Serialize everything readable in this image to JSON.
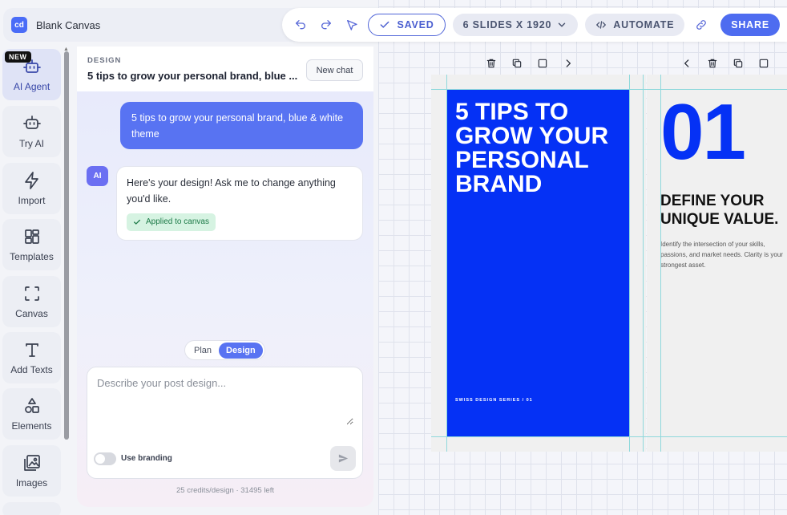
{
  "header": {
    "app_title": "Blank Canvas",
    "logo_text": "cd"
  },
  "toolbar": {
    "saved_label": "SAVED",
    "slides_label": "6 SLIDES X 1920",
    "automate_label": "AUTOMATE",
    "share_label": "SHARE"
  },
  "sidebar": {
    "new_badge": "NEW",
    "items": [
      {
        "label": "AI Agent"
      },
      {
        "label": "Try AI"
      },
      {
        "label": "Import"
      },
      {
        "label": "Templates"
      },
      {
        "label": "Canvas"
      },
      {
        "label": "Add Texts"
      },
      {
        "label": "Elements"
      },
      {
        "label": "Images"
      }
    ]
  },
  "chat": {
    "kicker": "DESIGN",
    "title": "5 tips to grow your personal brand, blue ...",
    "new_chat_label": "New chat",
    "user_message": "5 tips to grow your personal brand, blue & white theme",
    "ai_avatar": "AI",
    "ai_message": "Here's your design! Ask me to change anything you'd like.",
    "applied_label": "Applied to canvas",
    "mode_plan": "Plan",
    "mode_design": "Design",
    "input_placeholder": "Describe your post design...",
    "branding_label": "Use branding",
    "credits": "25 credits/design · 31495 left"
  },
  "slides": {
    "slide1_title": "5 TIPS TO GROW YOUR PERSONAL BRAND",
    "slide1_footer": "SWISS DESIGN SERIES / 01",
    "slide2_number": "01",
    "slide2_heading": "DEFINE YOUR UNIQUE VALUE.",
    "slide2_body": "Identify the intersection of your skills, passions, and market needs. Clarity is your strongest asset."
  },
  "colors": {
    "accent": "#4e6cf0",
    "slide_blue": "#0531f5"
  }
}
